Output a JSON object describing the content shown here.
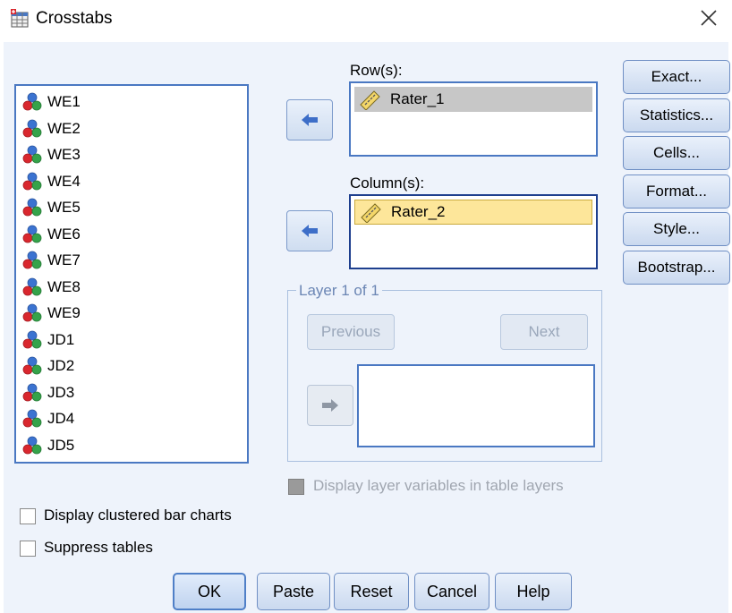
{
  "window": {
    "title": "Crosstabs",
    "close_icon": "close-icon"
  },
  "variables": [
    "WE1",
    "WE2",
    "WE3",
    "WE4",
    "WE5",
    "WE6",
    "WE7",
    "WE8",
    "WE9",
    "JD1",
    "JD2",
    "JD3",
    "JD4",
    "JD5"
  ],
  "rows": {
    "label": "Row(s):",
    "items": [
      "Rater_1"
    ]
  },
  "columns": {
    "label": "Column(s):",
    "items": [
      "Rater_2"
    ]
  },
  "layer": {
    "title": "Layer 1 of 1",
    "previous_label": "Previous",
    "next_label": "Next"
  },
  "side_buttons": [
    "Exact...",
    "Statistics...",
    "Cells...",
    "Format...",
    "Style...",
    "Bootstrap..."
  ],
  "options": {
    "display_layer_label": "Display layer variables in table layers",
    "clustered_label": "Display clustered bar charts",
    "suppress_label": "Suppress tables"
  },
  "bottom_buttons": [
    "OK",
    "Paste",
    "Reset",
    "Cancel",
    "Help"
  ],
  "colors": {
    "accent": "#4a78c2",
    "row_selected": "#c7c7c7",
    "column_selected": "#fde69a",
    "background": "#eef3fb"
  }
}
